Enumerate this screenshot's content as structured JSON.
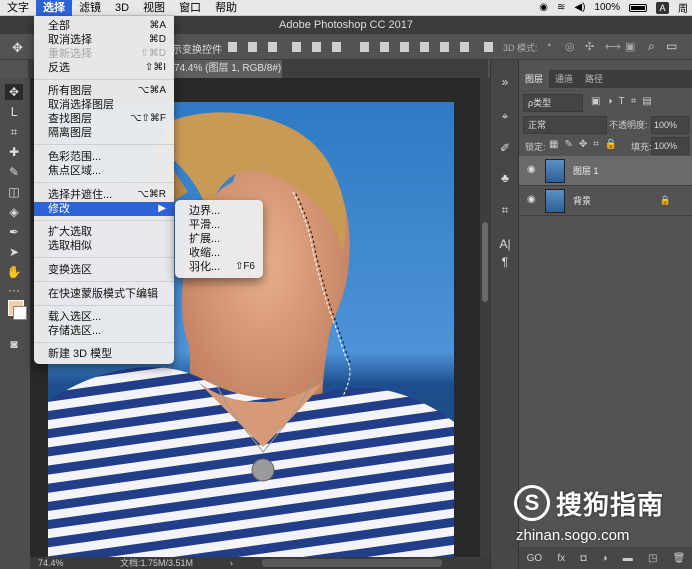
{
  "menubar": {
    "items": [
      "文字",
      "选择",
      "滤镜",
      "3D",
      "视图",
      "窗口",
      "帮助"
    ],
    "battery": "100%",
    "user": "周",
    "input_badge": "A"
  },
  "window": {
    "title": "Adobe Photoshop CC 2017"
  },
  "options_bar": {
    "transform_label": "示变换控件",
    "mode_3d": "3D 模式:"
  },
  "document": {
    "tab": "74.4% (图层 1, RGB/8#) *",
    "zoom": "74.4%",
    "doc_size": "文档:1.75M/3.51M"
  },
  "select_menu": {
    "items": [
      {
        "label": "全部",
        "shortcut": "⌘A"
      },
      {
        "label": "取消选择",
        "shortcut": "⌘D"
      },
      {
        "label": "重新选择",
        "shortcut": "⇧⌘D"
      },
      {
        "label": "反选",
        "shortcut": "⇧⌘I"
      },
      {
        "label": "所有图层",
        "shortcut": "⌥⌘A"
      },
      {
        "label": "取消选择图层",
        "shortcut": ""
      },
      {
        "label": "查找图层",
        "shortcut": "⌥⇧⌘F"
      },
      {
        "label": "隔离图层",
        "shortcut": ""
      },
      {
        "label": "色彩范围...",
        "shortcut": ""
      },
      {
        "label": "焦点区域...",
        "shortcut": ""
      },
      {
        "label": "选择并遮住...",
        "shortcut": "⌥⌘R"
      },
      {
        "label": "修改",
        "shortcut": "▶"
      },
      {
        "label": "扩大选取",
        "shortcut": ""
      },
      {
        "label": "选取相似",
        "shortcut": ""
      },
      {
        "label": "变换选区",
        "shortcut": ""
      },
      {
        "label": "在快速蒙版模式下编辑",
        "shortcut": ""
      },
      {
        "label": "载入选区...",
        "shortcut": ""
      },
      {
        "label": "存储选区...",
        "shortcut": ""
      },
      {
        "label": "新建 3D 模型",
        "shortcut": ""
      }
    ]
  },
  "modify_menu": {
    "items": [
      {
        "label": "边界...",
        "shortcut": ""
      },
      {
        "label": "平滑...",
        "shortcut": ""
      },
      {
        "label": "扩展...",
        "shortcut": ""
      },
      {
        "label": "收缩...",
        "shortcut": ""
      },
      {
        "label": "羽化...",
        "shortcut": "⇧F6"
      }
    ]
  },
  "layers_panel": {
    "tabs": [
      "图层",
      "通道",
      "路径"
    ],
    "filter": "ρ类型",
    "blend_mode": "正常",
    "opacity_label": "不透明度:",
    "opacity": "100%",
    "lock_label": "锁定:",
    "fill_label": "填充:",
    "fill": "100%",
    "layers": [
      {
        "name": "图层 1",
        "selected": true
      },
      {
        "name": "背景",
        "selected": false
      }
    ],
    "footer": [
      "GO",
      "fx",
      "◘",
      "◑",
      "▬",
      "◳",
      "🗑"
    ]
  },
  "watermark": {
    "logo": "S",
    "brand": "搜狗指南",
    "url": "zhinan.sogo.com"
  },
  "colors": {
    "foreground": "#f6cfa4",
    "background": "#ffffff",
    "highlight": "#2e63d8"
  }
}
